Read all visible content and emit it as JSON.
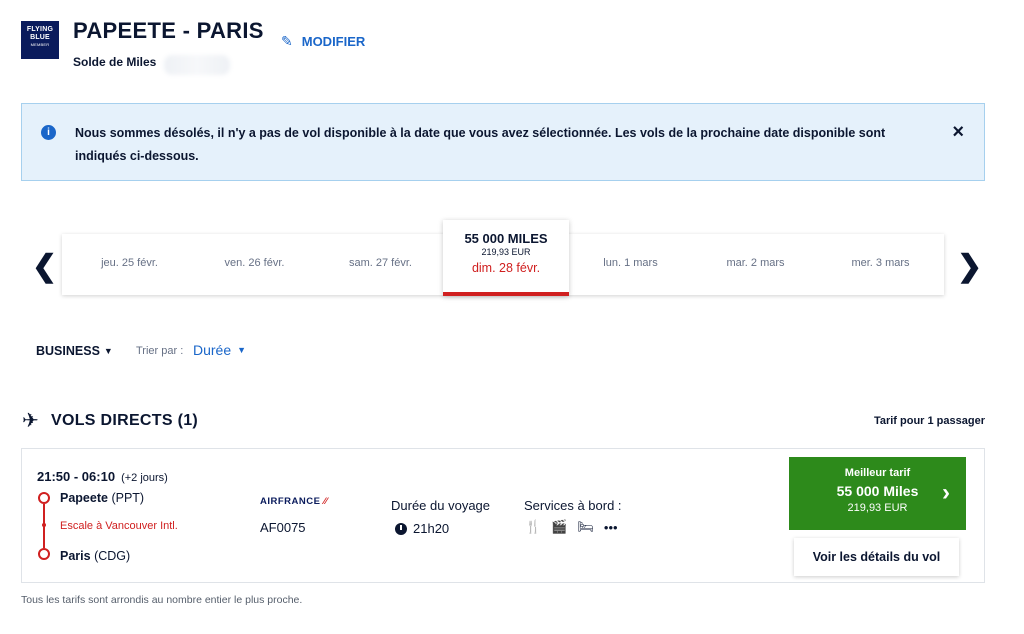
{
  "header": {
    "logo_line1": "FLYING",
    "logo_line2": "BLUE",
    "logo_line3": "MEMBER",
    "route": "PAPEETE - PARIS",
    "edit_label": "MODIFIER",
    "balance_label": "Solde de Miles"
  },
  "alert": {
    "message": "Nous sommes désolés, il n'y a pas de vol disponible à la date que vous avez sélectionnée. Les vols de la prochaine date disponible sont indiqués ci-dessous.",
    "close_icon": "×"
  },
  "carousel": {
    "prev_icon": "❮",
    "next_icon": "❯",
    "dates": [
      "jeu. 25 févr.",
      "ven. 26 févr.",
      "sam. 27 févr.",
      "lun. 1 mars",
      "mar. 2 mars",
      "mer. 3 mars"
    ],
    "selected": {
      "miles": "55 000  MILES",
      "eur": "219,93 EUR",
      "date": "dim. 28 févr."
    }
  },
  "filters": {
    "cabin": "BUSINESS",
    "sort_label": "Trier par :",
    "sort_value": "Durée"
  },
  "section": {
    "title": "VOLS DIRECTS (1)",
    "passenger_note": "Tarif pour 1 passager"
  },
  "flight": {
    "times": "21:50 - 06:10",
    "days": "(+2 jours)",
    "origin_city": "Papeete",
    "origin_code": "(PPT)",
    "stop": "Escale à Vancouver Intl.",
    "dest_city": "Paris",
    "dest_code": "(CDG)",
    "airline": "AIRFRANCE",
    "flight_number": "AF0075",
    "duration_label": "Durée du voyage",
    "duration": "21h20",
    "services_label": "Services à bord :",
    "best_title": "Meilleur tarif",
    "best_miles": "55 000  Miles",
    "best_eur": "219,93 EUR",
    "details_button": "Voir les détails du vol"
  },
  "footnote": "Tous les tarifs sont arrondis au nombre entier le plus proche.",
  "colors": {
    "accent_blue": "#1a66c9",
    "alert_red": "#d02020",
    "cta_green": "#2d8a1b",
    "navy": "#0a1b5c"
  }
}
